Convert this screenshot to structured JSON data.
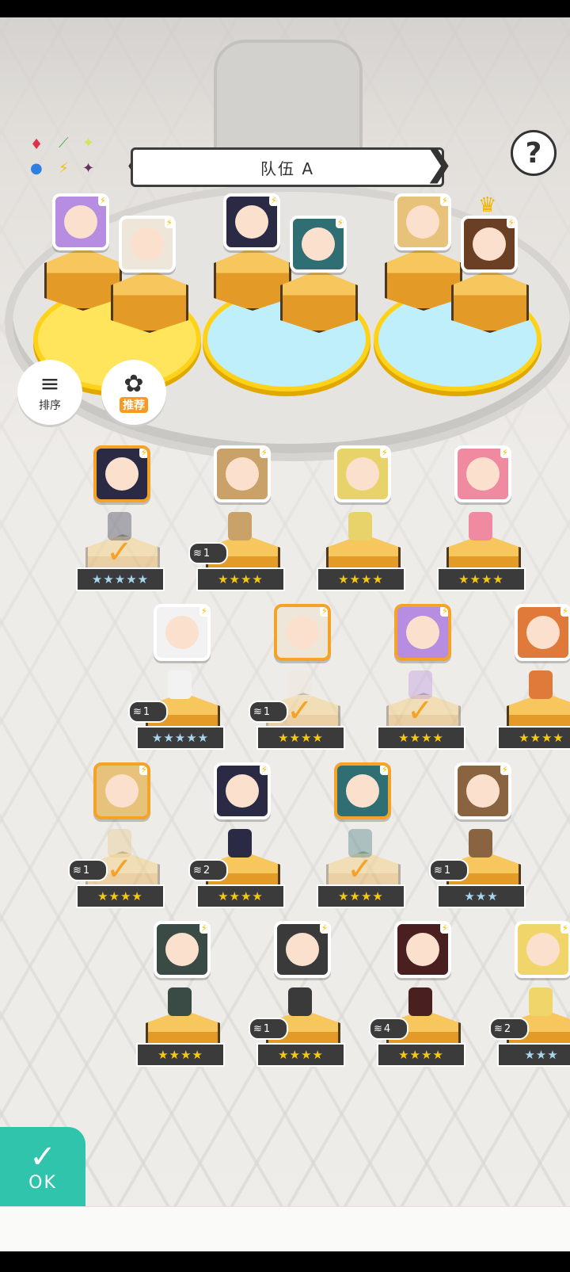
{
  "team": {
    "title": "队伍 A",
    "prev": "❮",
    "next": "❯"
  },
  "help": {
    "label": "?"
  },
  "element_icons": [
    "♦",
    "⟋",
    "✦",
    "●",
    "⚡",
    "✦"
  ],
  "buttons": {
    "sort_label": "排序",
    "recommend_label": "推荐",
    "ok_label": "OK"
  },
  "colors": {
    "accent": "#2fc4ab",
    "selected": "#f5a327",
    "star_gold": "#f6c90e",
    "star_blue": "#a8d6ef"
  },
  "team_slots": [
    {
      "hair": "#b68de0",
      "has_crown": false
    },
    {
      "hair": "#efe6da",
      "has_crown": false
    },
    {
      "hair": "#2a2a44",
      "has_crown": false
    },
    {
      "hair": "#2f6f73",
      "has_crown": false
    },
    {
      "hair": "#e6c27a",
      "has_crown": false
    },
    {
      "hair": "#6b3f23",
      "has_crown": true
    }
  ],
  "roster": [
    {
      "hair": "#2a2a44",
      "stars": "★★★★★",
      "star_color": "blue",
      "selected": true,
      "level": ""
    },
    {
      "hair": "#c9a26a",
      "stars": "★★★★",
      "star_color": "gold",
      "selected": false,
      "level": "1"
    },
    {
      "hair": "#e8d36b",
      "stars": "★★★★",
      "star_color": "gold",
      "selected": false,
      "level": ""
    },
    {
      "hair": "#f08aa0",
      "stars": "★★★★",
      "star_color": "gold",
      "selected": false,
      "level": ""
    },
    {
      "hair": "#f2f2f2",
      "stars": "★★★★★",
      "star_color": "blue",
      "selected": false,
      "level": "1"
    },
    {
      "hair": "#efe6da",
      "stars": "★★★★",
      "star_color": "gold",
      "selected": true,
      "level": "1"
    },
    {
      "hair": "#b68de0",
      "stars": "★★★★",
      "star_color": "gold",
      "selected": true,
      "level": ""
    },
    {
      "hair": "#e07a3a",
      "stars": "★★★★",
      "star_color": "gold",
      "selected": false,
      "level": ""
    },
    {
      "hair": "#e6c27a",
      "stars": "★★★★",
      "star_color": "gold",
      "selected": true,
      "level": "1"
    },
    {
      "hair": "#2a2a44",
      "stars": "★★★★",
      "star_color": "gold",
      "selected": false,
      "level": "2"
    },
    {
      "hair": "#2f6f73",
      "stars": "★★★★",
      "star_color": "gold",
      "selected": true,
      "level": ""
    },
    {
      "hair": "#8a6440",
      "stars": "★★★",
      "star_color": "blue",
      "selected": false,
      "level": "1"
    },
    {
      "hair": "#3a4a44",
      "stars": "★★★★",
      "star_color": "gold",
      "selected": false,
      "level": ""
    },
    {
      "hair": "#3a3a3a",
      "stars": "★★★★",
      "star_color": "gold",
      "selected": false,
      "level": "1"
    },
    {
      "hair": "#4a1f1f",
      "stars": "★★★★",
      "star_color": "gold",
      "selected": false,
      "level": "4"
    },
    {
      "hair": "#f0d66a",
      "stars": "★★★",
      "star_color": "blue",
      "selected": false,
      "level": "2"
    }
  ]
}
